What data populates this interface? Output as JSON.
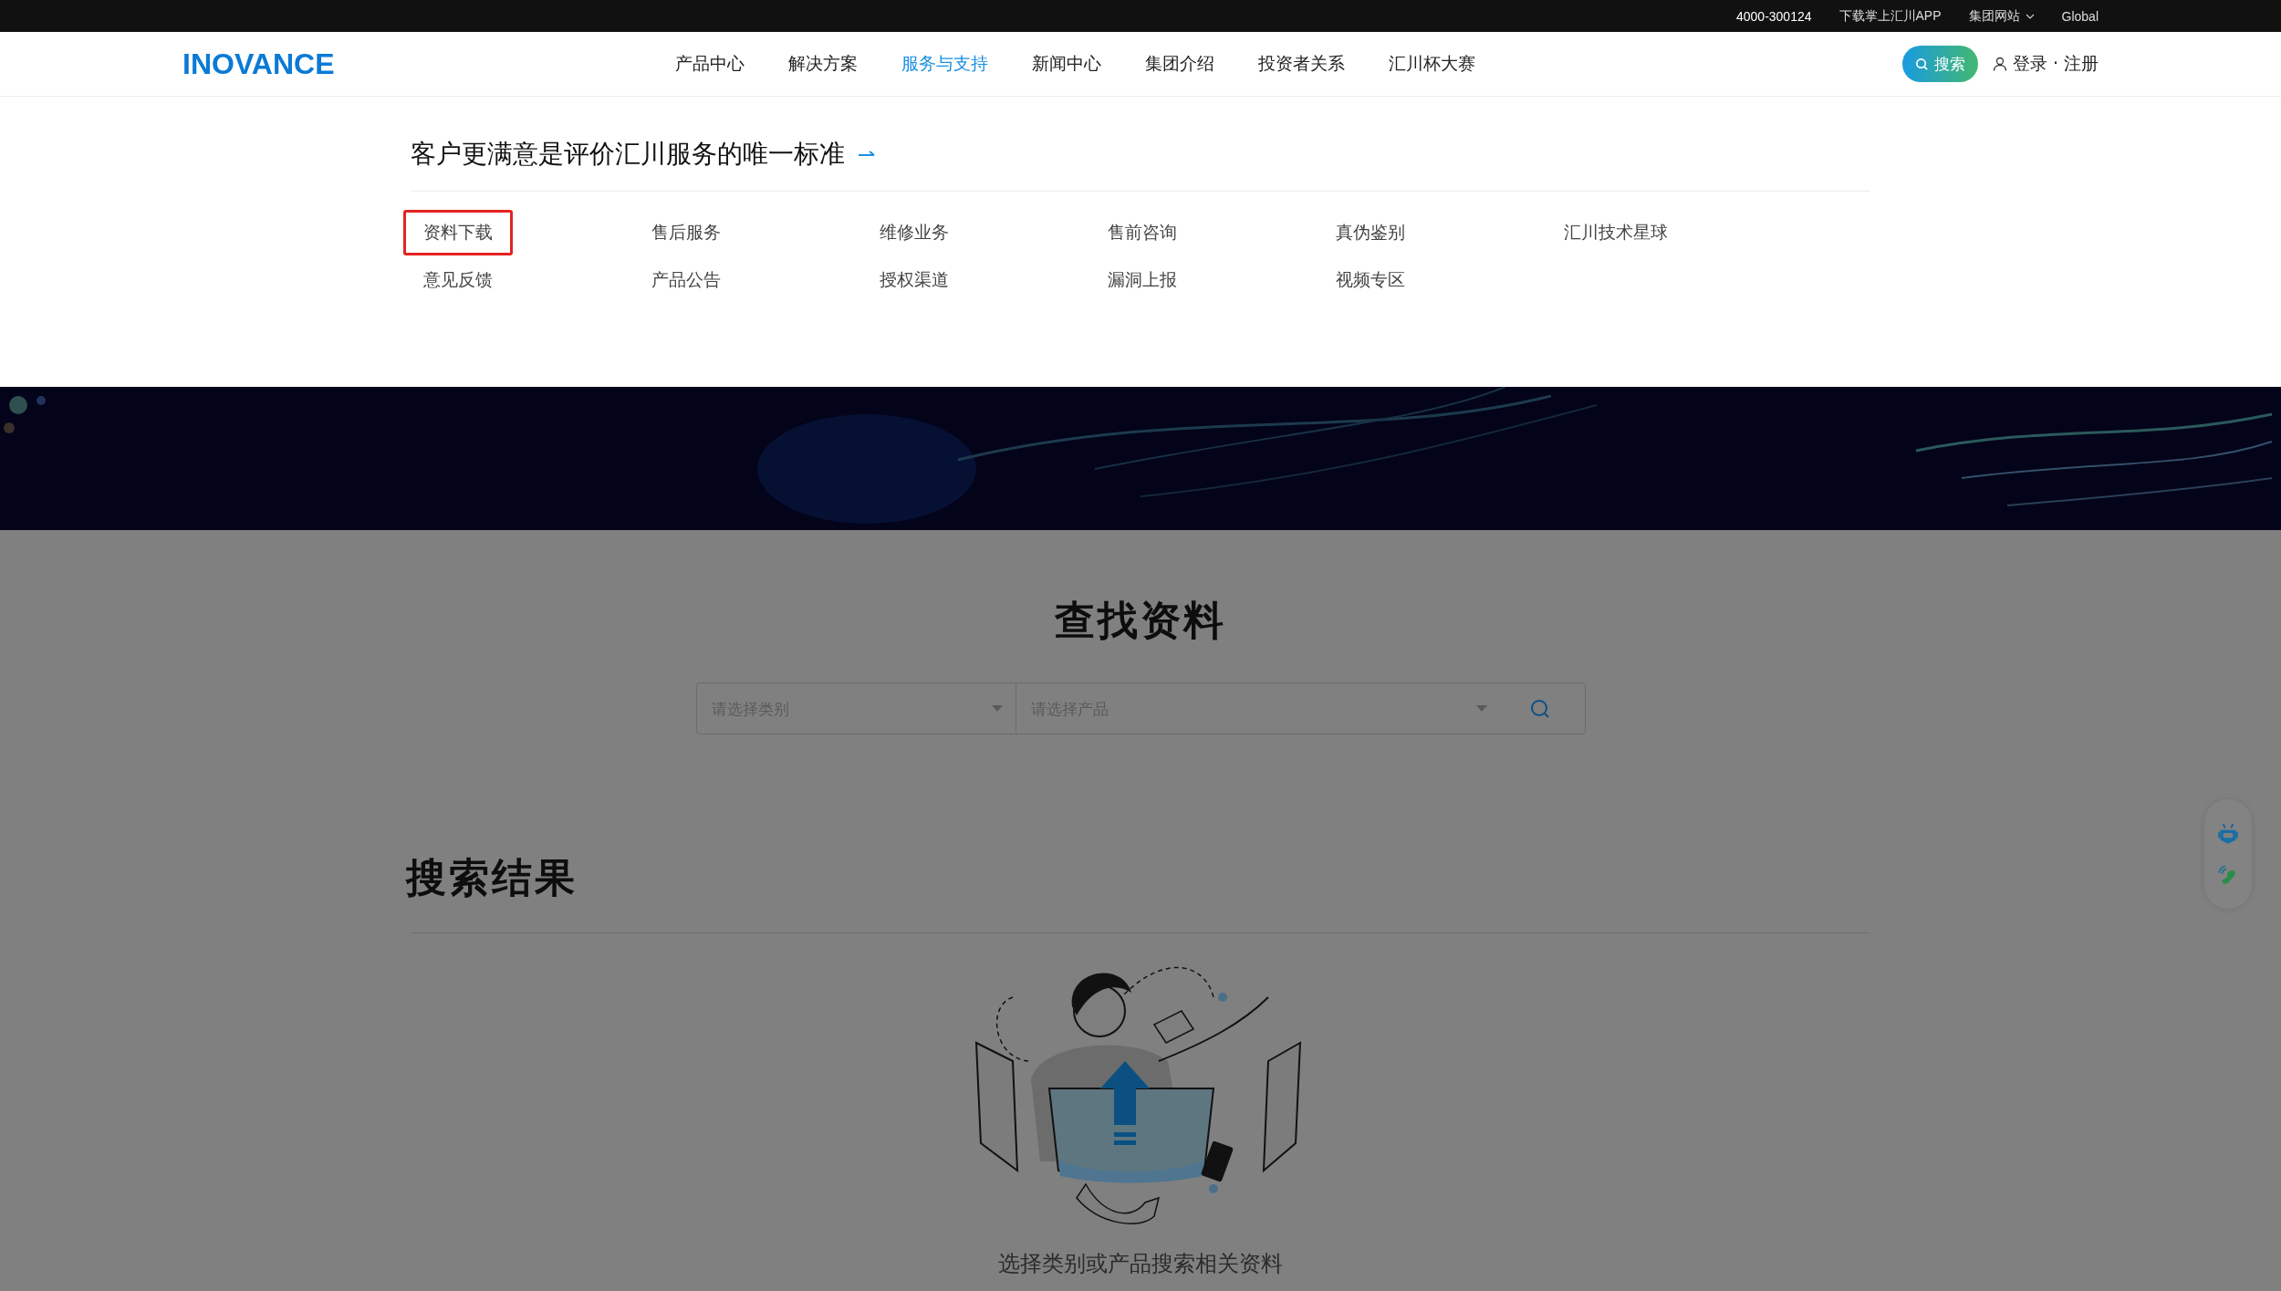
{
  "top_bar": {
    "phone": "4000-300124",
    "links": [
      {
        "label": "下载掌上汇川APP",
        "has_caret": false
      },
      {
        "label": "集团网站",
        "has_caret": true
      },
      {
        "label": "Global",
        "has_caret": false
      }
    ]
  },
  "nav": {
    "logo": "INOVANCE",
    "items": [
      {
        "label": "产品中心",
        "selected": false
      },
      {
        "label": "解决方案",
        "selected": false
      },
      {
        "label": "服务与支持",
        "selected": true
      },
      {
        "label": "新闻中心",
        "selected": false
      },
      {
        "label": "集团介绍",
        "selected": false
      },
      {
        "label": "投资者关系",
        "selected": false
      },
      {
        "label": "汇川杯大赛",
        "selected": false
      }
    ],
    "search_button": "搜索",
    "login": "登录 · 注册"
  },
  "menu": {
    "title": "客户更满意是评价汇川服务的唯一标准",
    "items": [
      {
        "label": "资料下载",
        "highlighted": true
      },
      {
        "label": "售后服务",
        "highlighted": false
      },
      {
        "label": "维修业务",
        "highlighted": false
      },
      {
        "label": "售前咨询",
        "highlighted": false
      },
      {
        "label": "真伪鉴别",
        "highlighted": false
      },
      {
        "label": "汇川技术星球",
        "highlighted": false
      },
      {
        "label": "意见反馈",
        "highlighted": false
      },
      {
        "label": "产品公告",
        "highlighted": false
      },
      {
        "label": "授权渠道",
        "highlighted": false
      },
      {
        "label": "漏洞上报",
        "highlighted": false
      },
      {
        "label": "视频专区",
        "highlighted": false
      }
    ]
  },
  "search": {
    "title": "查找资料",
    "category_select": {
      "placeholder": "请选择类别"
    },
    "product_select": {
      "placeholder": "请选择产品"
    }
  },
  "results": {
    "title": "搜索结果",
    "empty_message": "选择类别或产品搜索相关资料"
  }
}
